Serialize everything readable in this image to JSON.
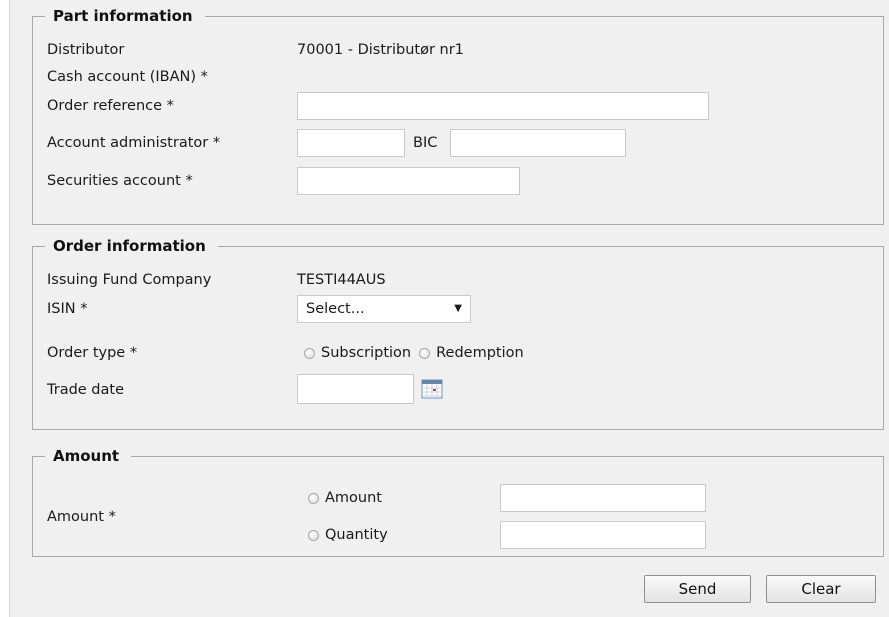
{
  "part_information": {
    "legend": "Part information",
    "distributor_label": "Distributor",
    "distributor_value": "70001 - Distributør nr1",
    "cash_account_label": "Cash account (IBAN) *",
    "order_reference_label": "Order reference *",
    "order_reference_value": "",
    "account_administrator_label": "Account administrator *",
    "account_administrator_value": "",
    "bic_label": "BIC",
    "bic_value": "",
    "securities_account_label": "Securities account *",
    "securities_account_value": ""
  },
  "order_information": {
    "legend": "Order information",
    "issuing_fund_company_label": "Issuing Fund Company",
    "issuing_fund_company_value": "TESTI44AUS",
    "isin_label": "ISIN *",
    "isin_selected": "Select...",
    "order_type_label": "Order type *",
    "order_type_options": [
      "Subscription",
      "Redemption"
    ],
    "trade_date_label": "Trade date",
    "trade_date_value": ""
  },
  "amount": {
    "legend": "Amount",
    "amount_label": "Amount *",
    "options": [
      "Amount",
      "Quantity"
    ],
    "amount_value": "",
    "quantity_value": ""
  },
  "actions": {
    "send_label": "Send",
    "clear_label": "Clear"
  },
  "icons": {
    "calendar": "calendar-icon",
    "dropdown": "chevron-down-icon"
  },
  "colors": {
    "panel_background": "#f0f0f0",
    "fieldset_border": "#a9a9a9",
    "input_border": "#c9c9c9"
  }
}
